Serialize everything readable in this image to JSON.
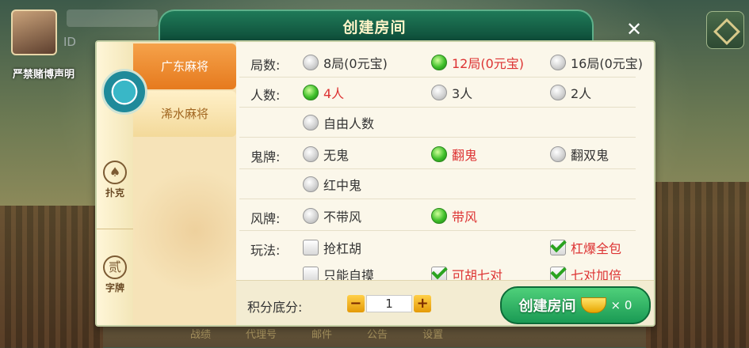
{
  "background": {
    "id_prefix": "ID",
    "notice": "严禁赌博声明",
    "bottom_nav": [
      "战绩",
      "代理号",
      "邮件",
      "公告",
      "设置"
    ]
  },
  "dialog": {
    "title": "创建房间",
    "close_icon": "close-icon",
    "categories": [
      {
        "label": "扑克",
        "icon": "spade-icon"
      },
      {
        "label": "字牌",
        "icon": "zipai-icon"
      }
    ],
    "tabs": [
      {
        "label": "广东麻将",
        "active": true
      },
      {
        "label": "浠水麻将",
        "active": false
      }
    ],
    "rows": [
      {
        "label": "局数:",
        "options": [
          {
            "text": "8局(0元宝)",
            "selected": false
          },
          {
            "text": "12局(0元宝)",
            "selected": true
          },
          {
            "text": "16局(0元宝)",
            "selected": false
          }
        ]
      },
      {
        "label": "人数:",
        "options": [
          {
            "text": "4人",
            "selected": true
          },
          {
            "text": "3人",
            "selected": false
          },
          {
            "text": "2人",
            "selected": false
          },
          {
            "text": "自由人数",
            "selected": false
          }
        ]
      },
      {
        "label": "鬼牌:",
        "options": [
          {
            "text": "无鬼",
            "selected": false
          },
          {
            "text": "翻鬼",
            "selected": true
          },
          {
            "text": "翻双鬼",
            "selected": false
          },
          {
            "text": "红中鬼",
            "selected": false
          }
        ]
      },
      {
        "label": "风牌:",
        "options": [
          {
            "text": "不带风",
            "selected": false
          },
          {
            "text": "带风",
            "selected": true
          }
        ]
      },
      {
        "label": "玩法:",
        "options": [
          {
            "text": "抢杠胡",
            "checked": false
          },
          {
            "text": "杠爆全包",
            "checked": true
          },
          {
            "text": "只能自摸",
            "checked": false
          },
          {
            "text": "可胡七对",
            "checked": true
          },
          {
            "text": "七对加倍",
            "checked": true
          }
        ]
      }
    ],
    "score": {
      "label": "积分底分:",
      "value": "1",
      "minus": "−",
      "plus": "+"
    },
    "create_button": {
      "label": "创建房间",
      "cost": "× 0"
    }
  }
}
